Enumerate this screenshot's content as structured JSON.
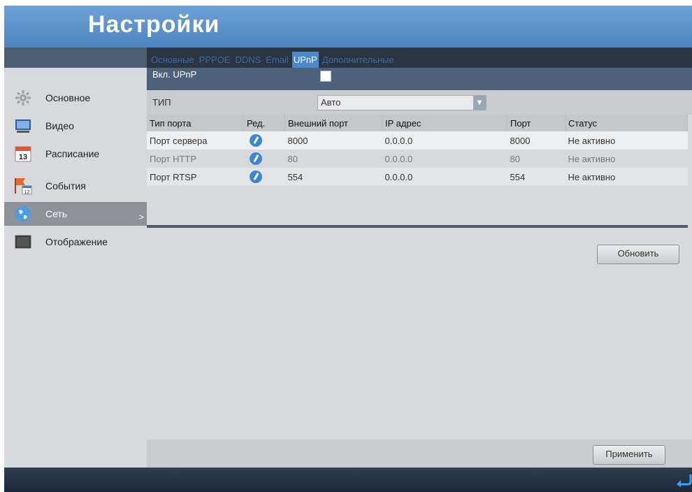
{
  "header": {
    "title": "Настройки"
  },
  "sidebar": {
    "items": [
      {
        "label": "Основное",
        "icon": "gear-icon"
      },
      {
        "label": "Видео",
        "icon": "monitor-icon"
      },
      {
        "label": "Расписание",
        "icon": "calendar-icon",
        "day": "13"
      },
      {
        "label": "События",
        "icon": "flag-icon",
        "day": "12"
      },
      {
        "label": "Сеть",
        "icon": "globe-icon",
        "arrow": ">",
        "active": true
      },
      {
        "label": "Отображение",
        "icon": "display-icon"
      }
    ]
  },
  "tabs": [
    {
      "label": "Основные"
    },
    {
      "label": "PPPOE"
    },
    {
      "label": "DDNS"
    },
    {
      "label": "Email"
    },
    {
      "label": "UPnP",
      "active": true
    },
    {
      "label": "Дополнительные"
    }
  ],
  "upnp": {
    "enable_label": "Вкл. UPnP",
    "enabled": true
  },
  "type": {
    "label": "ТИП",
    "value": "Авто"
  },
  "table": {
    "headers": [
      "Тип порта",
      "Ред.",
      "Внешний порт",
      "IP адрес",
      "Порт",
      "Статус"
    ],
    "rows": [
      {
        "port_type": "Порт сервера",
        "external_port": "8000",
        "ip": "0.0.0.0",
        "port": "8000",
        "status": "Не активно"
      },
      {
        "port_type": "Порт HTTP",
        "external_port": "80",
        "ip": "0.0.0.0",
        "port": "80",
        "status": "Не активно"
      },
      {
        "port_type": "Порт RTSP",
        "external_port": "554",
        "ip": "0.0.0.0",
        "port": "554",
        "status": "Не активно"
      }
    ]
  },
  "buttons": {
    "refresh": "Обновить",
    "apply": "Применить"
  },
  "colors": {
    "header": "#4d83bf",
    "active_tab": "#4a88cf",
    "sidebar_active": "#8c9299"
  }
}
